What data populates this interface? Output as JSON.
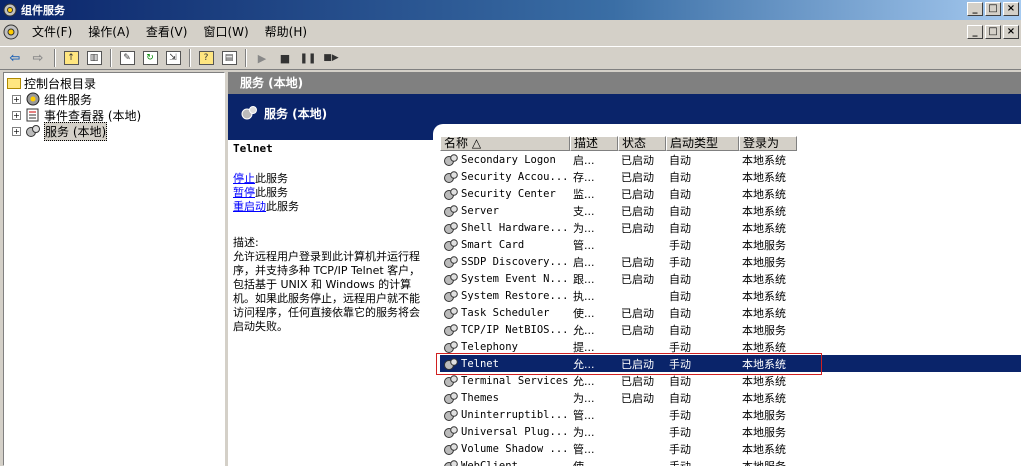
{
  "window": {
    "title": "组件服务"
  },
  "menu": [
    "文件(F)",
    "操作(A)",
    "查看(V)",
    "窗口(W)",
    "帮助(H)"
  ],
  "window_controls": [
    "_",
    "□",
    "×"
  ],
  "toolbar": {
    "icons": [
      "back-arrow-icon",
      "forward-arrow-icon",
      "up-folder-icon",
      "show-tree-icon",
      "properties-icon",
      "refresh-icon",
      "export-list-icon",
      "help-icon",
      "console-tree-icon",
      "play-icon",
      "stop-icon",
      "pause-icon",
      "restart-icon"
    ],
    "play": "▶",
    "stop": "■",
    "pause": "❚❚",
    "restart": "■▶"
  },
  "tree": {
    "root": "控制台根目录",
    "items": [
      {
        "label": "组件服务",
        "expand": "+"
      },
      {
        "label": "事件查看器 (本地)",
        "expand": "+"
      },
      {
        "label": "服务 (本地)",
        "expand": "+",
        "selected": true
      }
    ]
  },
  "panel": {
    "crumb": "服务 (本地)",
    "banner": "服务 (本地)"
  },
  "detail": {
    "service_name": "Telnet",
    "actions": [
      {
        "link": "停止",
        "rest": "此服务"
      },
      {
        "link": "暂停",
        "rest": "此服务"
      },
      {
        "link": "重启动",
        "rest": "此服务"
      }
    ],
    "desc_heading": "描述:",
    "description": "允许远程用户登录到此计算机并运行程序，并支持多种 TCP/IP Telnet 客户，包括基于 UNIX 和 Windows 的计算机。如果此服务停止，远程用户就不能访问程序，任何直接依靠它的服务将会启动失败。"
  },
  "list": {
    "columns": [
      "名称 △",
      "描述",
      "状态",
      "启动类型",
      "登录为"
    ],
    "rows": [
      [
        "Secondary Logon",
        "启...",
        "已启动",
        "自动",
        "本地系统"
      ],
      [
        "Security Accou...",
        "存...",
        "已启动",
        "自动",
        "本地系统"
      ],
      [
        "Security Center",
        "监...",
        "已启动",
        "自动",
        "本地系统"
      ],
      [
        "Server",
        "支...",
        "已启动",
        "自动",
        "本地系统"
      ],
      [
        "Shell Hardware...",
        "为...",
        "已启动",
        "自动",
        "本地系统"
      ],
      [
        "Smart Card",
        "管...",
        "",
        "手动",
        "本地服务"
      ],
      [
        "SSDP Discovery...",
        "启...",
        "已启动",
        "手动",
        "本地服务"
      ],
      [
        "System Event N...",
        "跟...",
        "已启动",
        "自动",
        "本地系统"
      ],
      [
        "System Restore...",
        "执...",
        "",
        "自动",
        "本地系统"
      ],
      [
        "Task Scheduler",
        "使...",
        "已启动",
        "自动",
        "本地系统"
      ],
      [
        "TCP/IP NetBIOS...",
        "允...",
        "已启动",
        "自动",
        "本地服务"
      ],
      [
        "Telephony",
        "提...",
        "",
        "手动",
        "本地系统"
      ],
      [
        "Telnet",
        "允...",
        "已启动",
        "手动",
        "本地系统"
      ],
      [
        "Terminal Services",
        "允...",
        "已启动",
        "自动",
        "本地系统"
      ],
      [
        "Themes",
        "为...",
        "已启动",
        "自动",
        "本地系统"
      ],
      [
        "Uninterruptibl...",
        "管...",
        "",
        "手动",
        "本地服务"
      ],
      [
        "Universal Plug...",
        "为...",
        "",
        "手动",
        "本地服务"
      ],
      [
        "Volume Shadow ...",
        "管...",
        "",
        "手动",
        "本地系统"
      ],
      [
        "WebClient",
        "使...",
        "",
        "手动",
        "本地服务"
      ]
    ],
    "selected_index": 12
  }
}
